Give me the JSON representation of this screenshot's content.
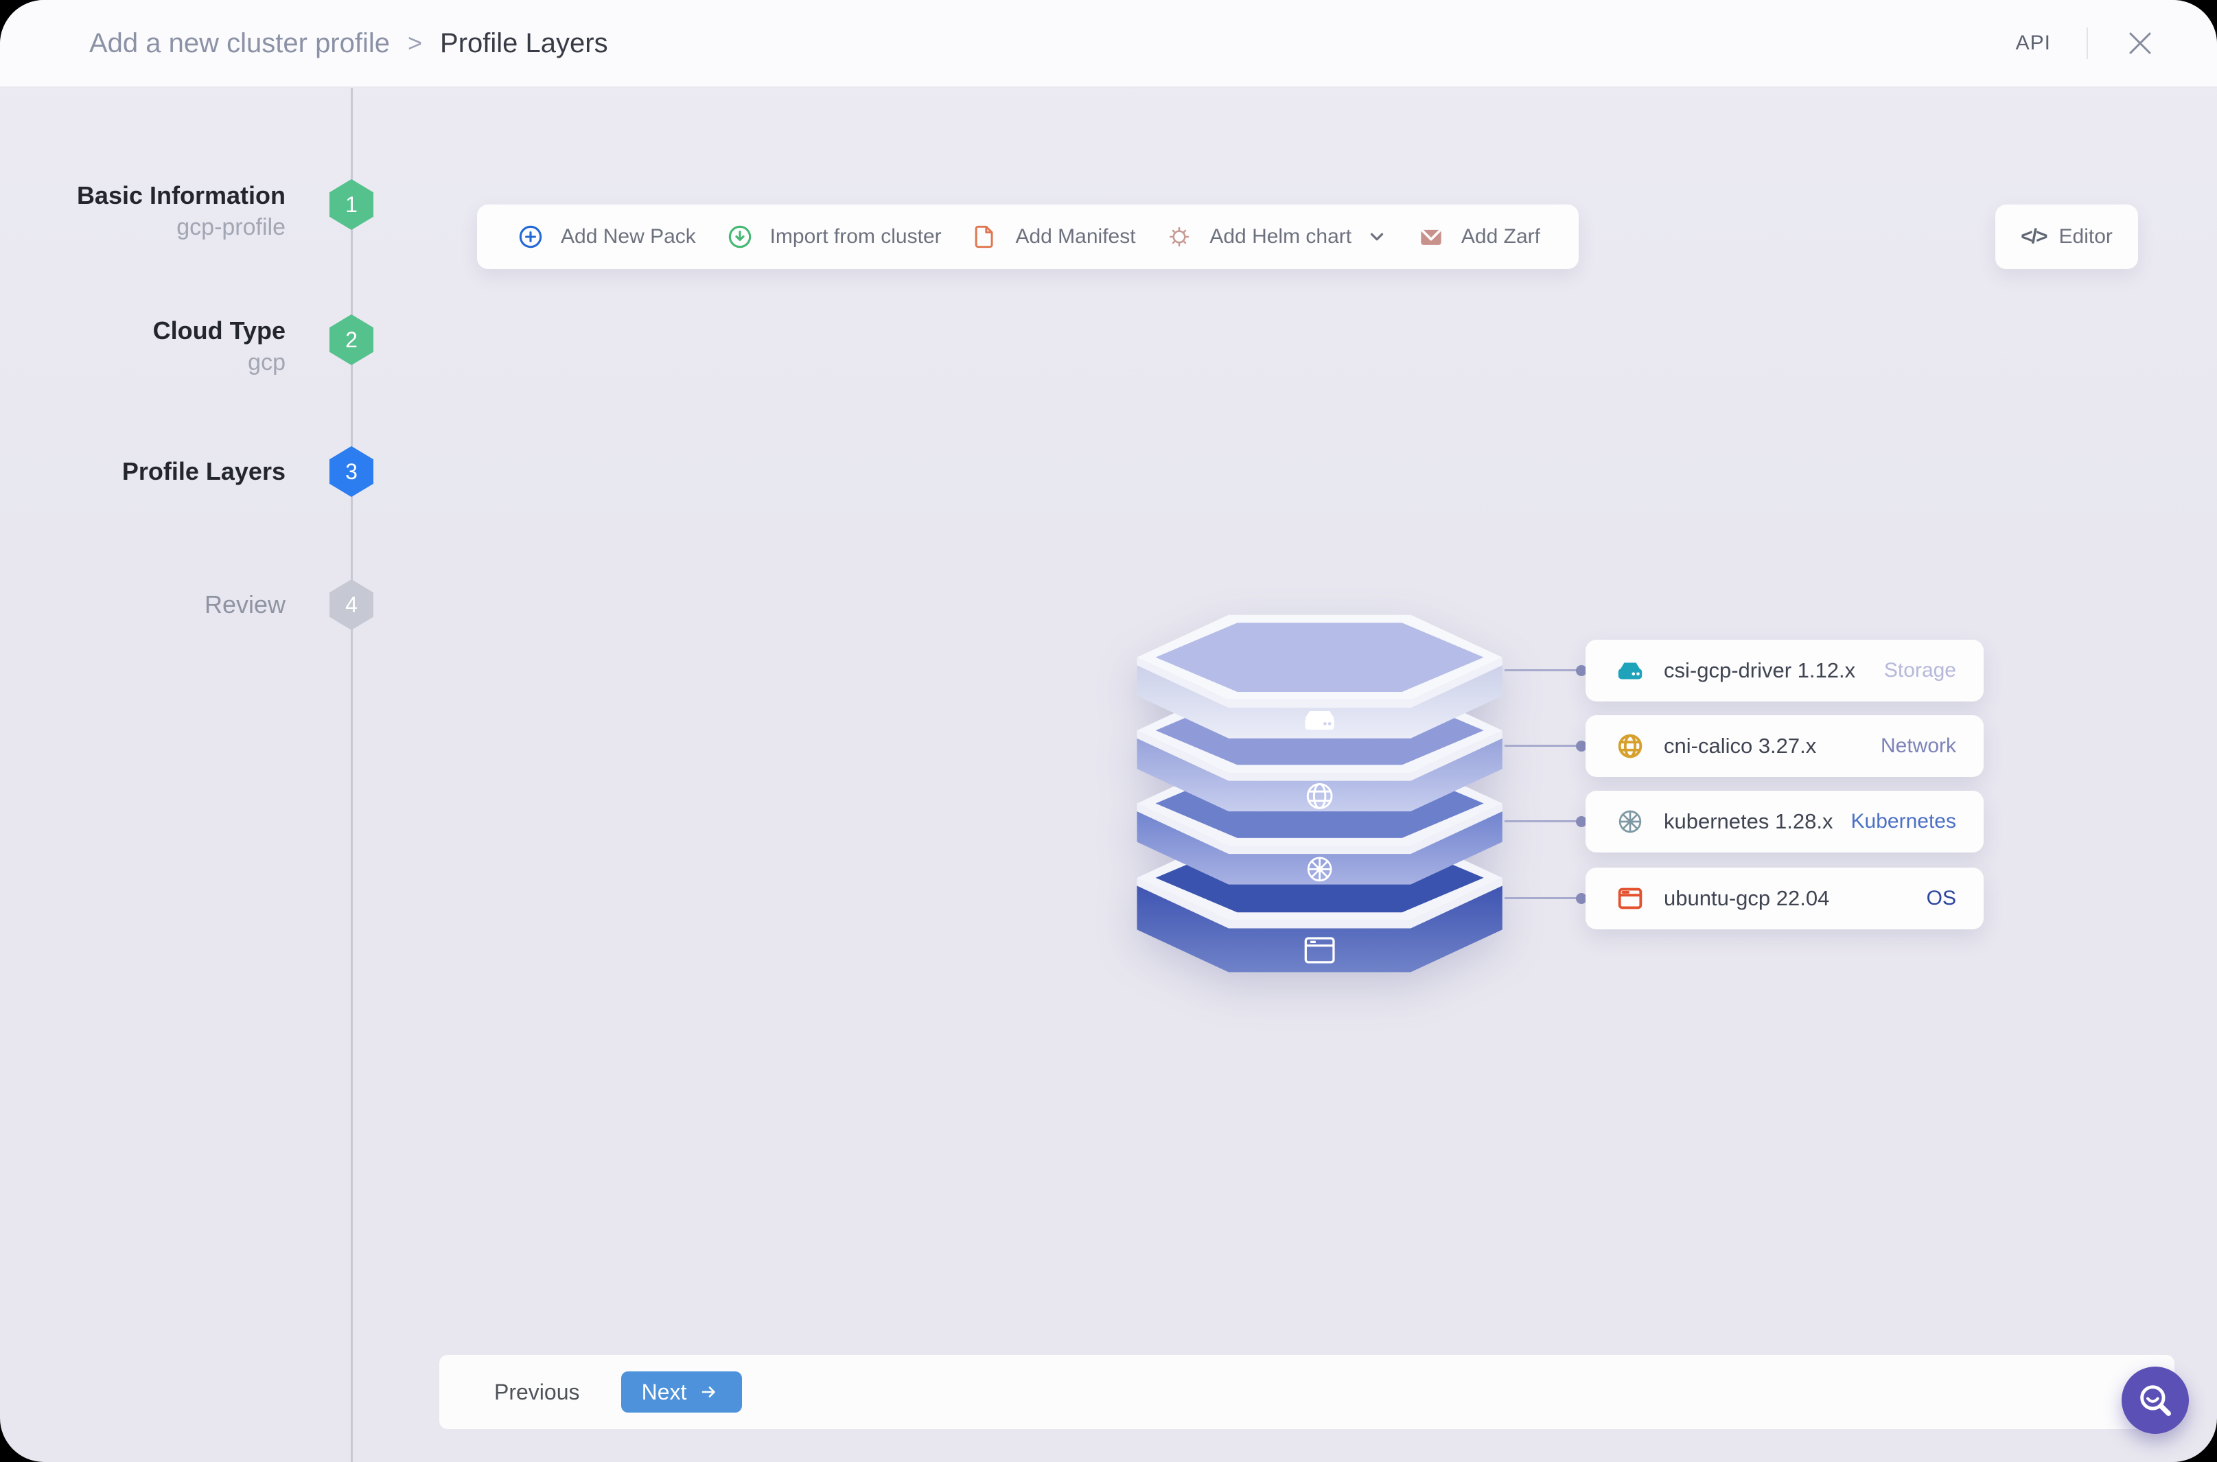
{
  "header": {
    "breadcrumb": "Add a new cluster profile",
    "separator": ">",
    "title": "Profile Layers",
    "api_label": "API"
  },
  "steps": [
    {
      "number": "1",
      "title": "Basic Information",
      "subtitle": "gcp-profile",
      "state": "done"
    },
    {
      "number": "2",
      "title": "Cloud Type",
      "subtitle": "gcp",
      "state": "done"
    },
    {
      "number": "3",
      "title": "Profile Layers",
      "subtitle": "",
      "state": "active"
    },
    {
      "number": "4",
      "title": "Review",
      "subtitle": "",
      "state": "pending"
    }
  ],
  "toolbar": {
    "add_new_pack": "Add New Pack",
    "import_from_cluster": "Import from cluster",
    "add_manifest": "Add Manifest",
    "add_helm_chart": "Add Helm chart",
    "add_zarf": "Add Zarf",
    "editor_glyph": "</>",
    "editor_label": "Editor"
  },
  "layers": [
    {
      "name": "csi-gcp-driver 1.12.x",
      "type": "Storage",
      "type_color": "#b5b8d9",
      "icon": "storage-drive-icon",
      "layer_color": "#b5bce7"
    },
    {
      "name": "cni-calico 3.27.x",
      "type": "Network",
      "type_color": "#7d82b8",
      "icon": "globe-icon",
      "layer_color": "#8e9bd8"
    },
    {
      "name": "kubernetes 1.28.x",
      "type": "Kubernetes",
      "type_color": "#4b70c4",
      "icon": "kubernetes-wheel-icon",
      "layer_color": "#6c7fcb"
    },
    {
      "name": "ubuntu-gcp 22.04",
      "type": "OS",
      "type_color": "#2a459e",
      "icon": "os-window-icon",
      "layer_color": "#3a53ae"
    }
  ],
  "footer": {
    "previous": "Previous",
    "next": "Next"
  },
  "colors": {
    "step_done": "#55c18c",
    "step_active": "#2b7df0",
    "step_pending": "#c6c9d3",
    "next_button": "#4d92da",
    "fab_purple": "#5a50b5",
    "connector": "#878cba",
    "background": "#e8e7f0"
  }
}
